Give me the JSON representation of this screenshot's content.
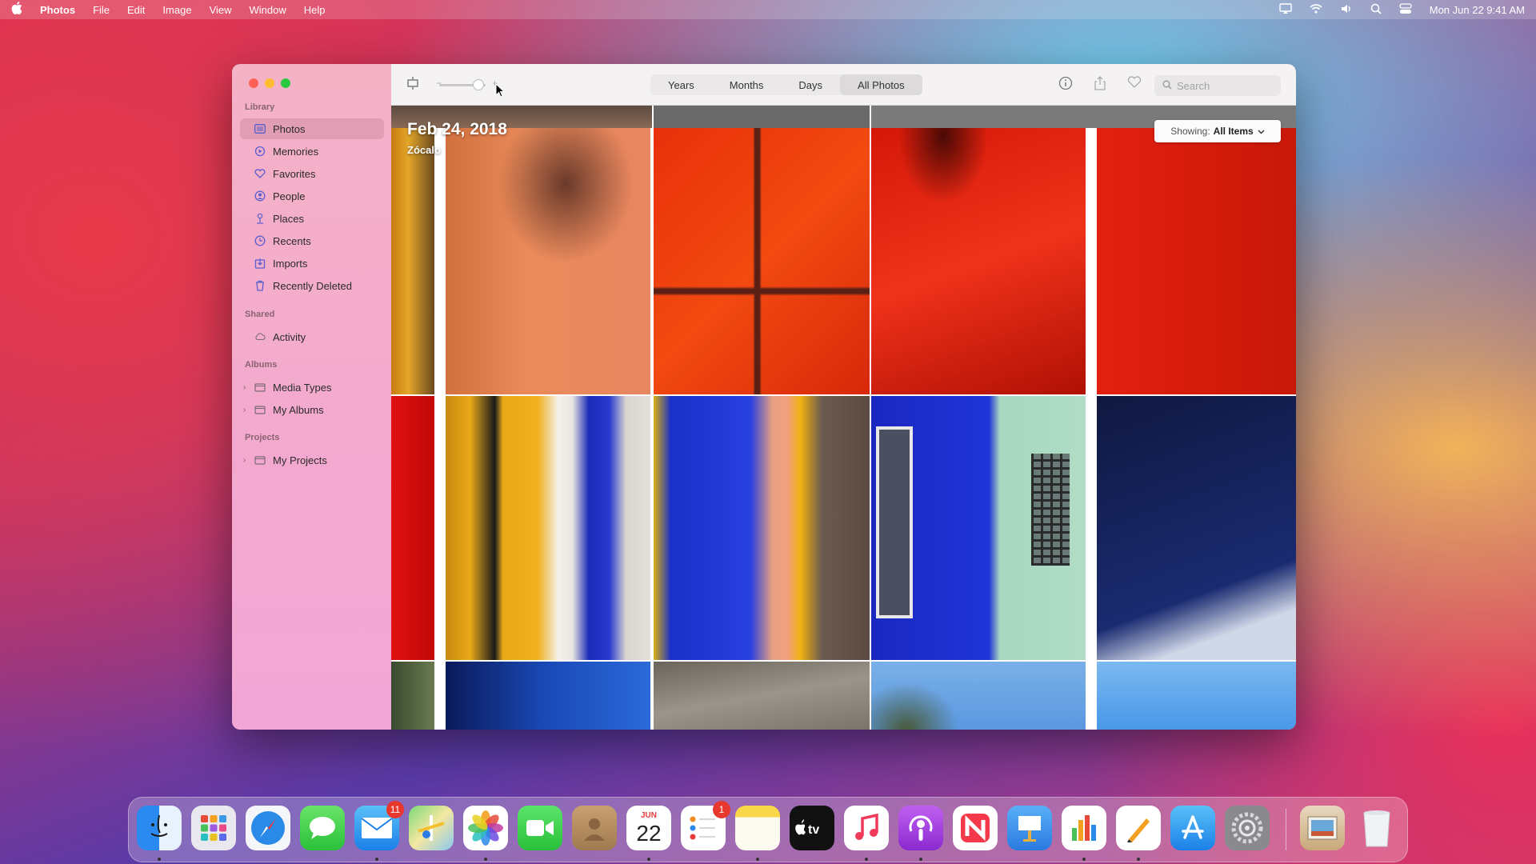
{
  "menubar": {
    "apple": "",
    "app": "Photos",
    "menus": [
      "File",
      "Edit",
      "Image",
      "View",
      "Window",
      "Help"
    ],
    "clock": "Mon Jun 22  9:41 AM"
  },
  "sidebar": {
    "library_label": "Library",
    "library": [
      {
        "label": "Photos",
        "icon": "photos-icon",
        "selected": true
      },
      {
        "label": "Memories",
        "icon": "memories-icon"
      },
      {
        "label": "Favorites",
        "icon": "heart-icon"
      },
      {
        "label": "People",
        "icon": "person-icon"
      },
      {
        "label": "Places",
        "icon": "pin-icon"
      },
      {
        "label": "Recents",
        "icon": "clock-icon"
      },
      {
        "label": "Imports",
        "icon": "import-icon"
      },
      {
        "label": "Recently Deleted",
        "icon": "trash-icon"
      }
    ],
    "shared_label": "Shared",
    "shared": [
      {
        "label": "Activity",
        "icon": "cloud-icon"
      }
    ],
    "albums_label": "Albums",
    "albums": [
      {
        "label": "Media Types",
        "icon": "folder-icon"
      },
      {
        "label": "My Albums",
        "icon": "folder-icon"
      }
    ],
    "projects_label": "Projects",
    "projects": [
      {
        "label": "My Projects",
        "icon": "folder-icon"
      }
    ]
  },
  "toolbar": {
    "tabs": [
      "Years",
      "Months",
      "Days",
      "All Photos"
    ],
    "active_tab": "All Photos",
    "search_placeholder": "Search",
    "zoom_level": 0.85
  },
  "content": {
    "date": "Feb 24, 2018",
    "location": "Zócalo",
    "showing_label": "Showing:",
    "showing_value": "All Items"
  },
  "dock": {
    "apps": [
      "Finder",
      "Launchpad",
      "Safari",
      "Messages",
      "Mail",
      "Maps",
      "Photos",
      "FaceTime",
      "Contacts",
      "Calendar",
      "Reminders",
      "Notes",
      "TV",
      "Music",
      "Podcasts",
      "News",
      "Keynote",
      "Numbers",
      "Pages",
      "App Store",
      "System Preferences",
      "Downloads",
      "Trash"
    ],
    "mail_badge": "11",
    "reminders_badge": "1",
    "calendar_month": "JUN",
    "calendar_day": "22"
  },
  "colors": {
    "accent": "#6a6cd8",
    "sidebar": "#f4b2c6",
    "close": "#fe5f57",
    "min": "#febc2e",
    "max": "#28c840"
  }
}
